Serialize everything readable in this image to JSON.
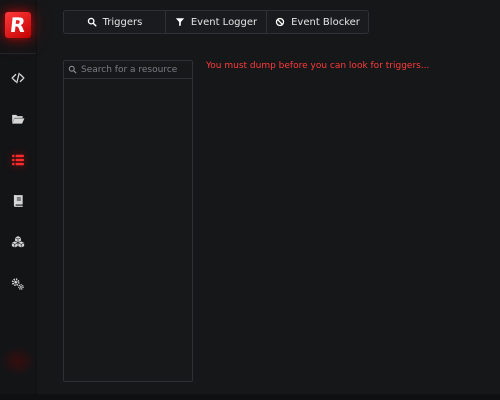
{
  "app": {
    "logo_letter": "R",
    "accent_color": "#ff2b2b"
  },
  "sidebar": {
    "items": [
      {
        "icon": "code-icon",
        "active": false
      },
      {
        "icon": "folder-open-icon",
        "active": false
      },
      {
        "icon": "list-icon",
        "active": true
      },
      {
        "icon": "book-icon",
        "active": false
      },
      {
        "icon": "cubes-icon",
        "active": false
      },
      {
        "icon": "gears-icon",
        "active": false
      }
    ]
  },
  "tabs": [
    {
      "label": "Triggers",
      "icon": "search-icon"
    },
    {
      "label": "Event Logger",
      "icon": "filter-icon"
    },
    {
      "label": "Event Blocker",
      "icon": "block-icon"
    }
  ],
  "resources": {
    "search_placeholder": "Search for a resource",
    "items": []
  },
  "main": {
    "message": "You must dump before you can look for triggers..."
  }
}
